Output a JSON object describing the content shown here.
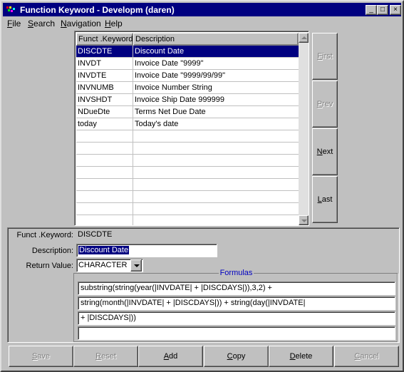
{
  "window": {
    "title": "Function Keyword - Developm (daren)",
    "controls": {
      "minimize": "_",
      "maximize": "□",
      "close": "×"
    }
  },
  "menu": [
    {
      "label": "File",
      "accel": "F",
      "rest": "ile"
    },
    {
      "label": "Search",
      "accel": "S",
      "rest": "earch"
    },
    {
      "label": "Navigation",
      "accel": "N",
      "rest": "avigation"
    },
    {
      "label": "Help",
      "accel": "H",
      "rest": "elp"
    }
  ],
  "grid": {
    "columns": [
      "Funct .Keyword",
      "Description"
    ],
    "rows": [
      {
        "keyword": "DISCDTE",
        "description": "Discount Date",
        "selected": true
      },
      {
        "keyword": "INVDT",
        "description": "Invoice Date \"9999\""
      },
      {
        "keyword": "INVDTE",
        "description": "Invoice Date \"9999/99/99\""
      },
      {
        "keyword": "INVNUMB",
        "description": "Invoice Number String"
      },
      {
        "keyword": "INVSHDT",
        "description": "Invoice Ship Date 999999"
      },
      {
        "keyword": "NDueDte",
        "description": "Terms Net Due Date"
      },
      {
        "keyword": "today",
        "description": "Today's date"
      },
      {
        "keyword": "",
        "description": ""
      },
      {
        "keyword": "",
        "description": ""
      },
      {
        "keyword": "",
        "description": ""
      },
      {
        "keyword": "",
        "description": ""
      },
      {
        "keyword": "",
        "description": ""
      },
      {
        "keyword": "",
        "description": ""
      },
      {
        "keyword": "",
        "description": ""
      },
      {
        "keyword": "",
        "description": ""
      }
    ]
  },
  "nav": {
    "first": {
      "label": "First",
      "accel": "F",
      "rest": "irst",
      "enabled": false
    },
    "prev": {
      "label": "Prev",
      "accel": "P",
      "rest": "rev",
      "enabled": false
    },
    "next": {
      "label": "Next",
      "accel": "N",
      "rest": "ext",
      "enabled": true
    },
    "last": {
      "label": "Last",
      "accel": "L",
      "rest": "ast",
      "enabled": true
    }
  },
  "detail": {
    "keyword_label": "Funct .Keyword:",
    "keyword_value": "DISCDTE",
    "description_label": "Description:",
    "description_value": "Discount Date",
    "return_label": "Return Value:",
    "return_value": "CHARACTER",
    "formulas_label": "Formulas",
    "formulas": [
      "substring(string(year(|INVDATE| + |DISCDAYS|)),3,2) +",
      "string(month(|INVDATE| + |DISCDAYS|)) + string(day(|INVDATE|",
      " + |DISCDAYS|))",
      ""
    ]
  },
  "buttons": {
    "save": {
      "label": "Save",
      "accel": "S",
      "rest": "ave",
      "enabled": false
    },
    "reset": {
      "label": "Reset",
      "accel": "R",
      "rest": "eset",
      "enabled": false
    },
    "add": {
      "label": "Add",
      "accel": "A",
      "rest": "dd",
      "enabled": true
    },
    "copy": {
      "label": "Copy",
      "accel": "C",
      "rest": "opy",
      "enabled": true
    },
    "delete": {
      "label": "Delete",
      "accel": "D",
      "rest": "elete",
      "enabled": true
    },
    "cancel": {
      "label": "Cancel",
      "accel": "C",
      "rest": "ancel",
      "enabled": false
    }
  },
  "colors": {
    "titlebar": "#000080",
    "selection": "#000080",
    "formulas_label": "#0000c0",
    "face": "#c0c0c0"
  }
}
